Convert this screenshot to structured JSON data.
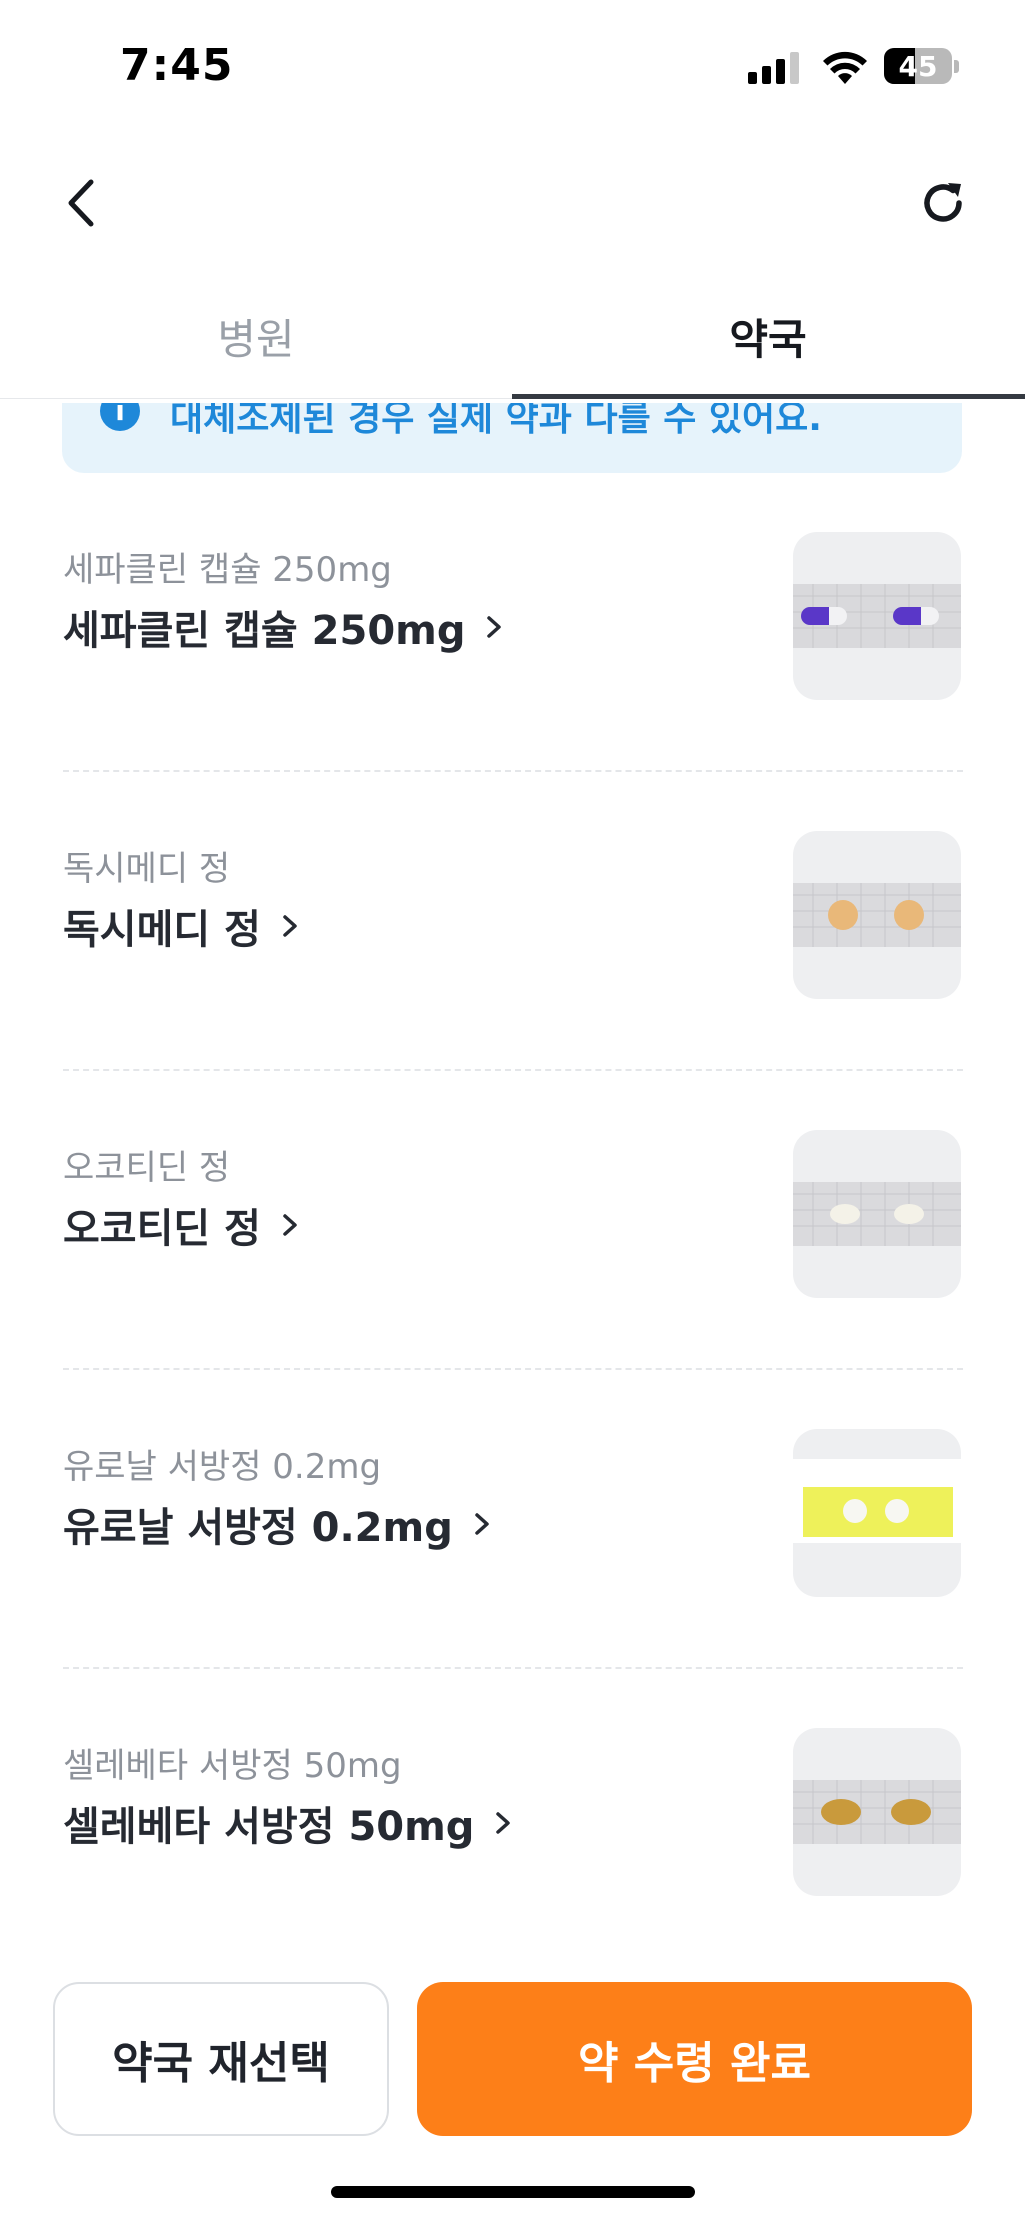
{
  "status_bar": {
    "time": "7:45",
    "battery": "45",
    "battery_level": 0.45
  },
  "header": {
    "back_icon": "chevron-left-icon",
    "refresh_icon": "refresh-icon"
  },
  "tabs": [
    {
      "label": "병원",
      "active": false
    },
    {
      "label": "약국",
      "active": true
    }
  ],
  "notice": {
    "icon": "info-icon",
    "icon_glyph": "i",
    "text": "대체조제된 경우 실제 약과 다를 수 있어요."
  },
  "medications": [
    {
      "subtitle": "세파클린 캡슐 250mg",
      "name": "세파클린 캡슐 250mg",
      "pill": "capsule-purple"
    },
    {
      "subtitle": "독시메디 정",
      "name": "독시메디 정",
      "pill": "round-orange"
    },
    {
      "subtitle": "오코티딘 정",
      "name": "오코티딘 정",
      "pill": "oval-white"
    },
    {
      "subtitle": "유로날 서방정 0.2mg",
      "name": "유로날 서방정 0.2mg",
      "pill": "round-white-yellow-bg"
    },
    {
      "subtitle": "셀레베타 서방정 50mg",
      "name": "셀레베타 서방정 50mg",
      "pill": "oval-brown"
    }
  ],
  "footer": {
    "reselect_label": "약국 재선택",
    "complete_label": "약 수령 완료"
  },
  "colors": {
    "accent": "#fd7f18",
    "info": "#1e88d9",
    "info_bg": "#e6f3fb"
  }
}
